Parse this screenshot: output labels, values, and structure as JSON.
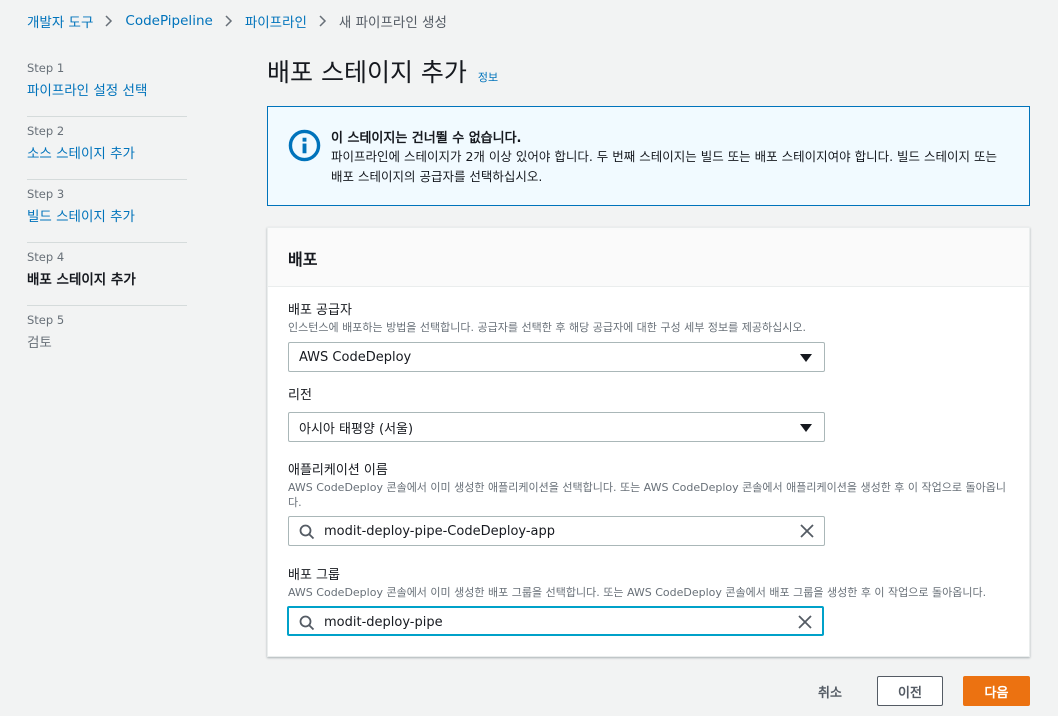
{
  "breadcrumb": {
    "items": [
      "개발자 도구",
      "CodePipeline",
      "파이프라인"
    ],
    "current": "새 파이프라인 생성"
  },
  "steps": [
    {
      "num": "Step 1",
      "label": "파이프라인 설정 선택",
      "state": "link"
    },
    {
      "num": "Step 2",
      "label": "소스 스테이지 추가",
      "state": "link"
    },
    {
      "num": "Step 3",
      "label": "빌드 스테이지 추가",
      "state": "link"
    },
    {
      "num": "Step 4",
      "label": "배포 스테이지 추가",
      "state": "active"
    },
    {
      "num": "Step 5",
      "label": "검토",
      "state": "disabled"
    }
  ],
  "page": {
    "title": "배포 스테이지 추가",
    "info_link": "정보"
  },
  "alert": {
    "title": "이 스테이지는 건너뛸 수 없습니다.",
    "body": "파이프라인에 스테이지가 2개 이상 있어야 합니다. 두 번째 스테이지는 빌드 또는 배포 스테이지여야 합니다. 빌드 스테이지 또는 배포 스테이지의 공급자를 선택하십시오.",
    "color": "#0073bb"
  },
  "panel": {
    "title": "배포",
    "provider": {
      "label": "배포 공급자",
      "description": "인스턴스에 배포하는 방법을 선택합니다. 공급자를 선택한 후 해당 공급자에 대한 구성 세부 정보를 제공하십시오.",
      "value": "AWS CodeDeploy"
    },
    "region": {
      "label": "리전",
      "value": "아시아 태평양 (서울)"
    },
    "application": {
      "label": "애플리케이션 이름",
      "description": "AWS CodeDeploy 콘솔에서 이미 생성한 애플리케이션을 선택합니다. 또는 AWS CodeDeploy 콘솔에서 애플리케이션을 생성한 후 이 작업으로 돌아옵니다.",
      "value": "modit-deploy-pipe-CodeDeploy-app"
    },
    "deploy_group": {
      "label": "배포 그룹",
      "description": "AWS CodeDeploy 콘솔에서 이미 생성한 배포 그룹을 선택합니다. 또는 AWS CodeDeploy 콘솔에서 배포 그룹을 생성한 후 이 작업으로 돌아옵니다.",
      "value": "modit-deploy-pipe"
    }
  },
  "buttons": {
    "cancel": "취소",
    "previous": "이전",
    "next": "다음",
    "accent": "#ec7211"
  }
}
